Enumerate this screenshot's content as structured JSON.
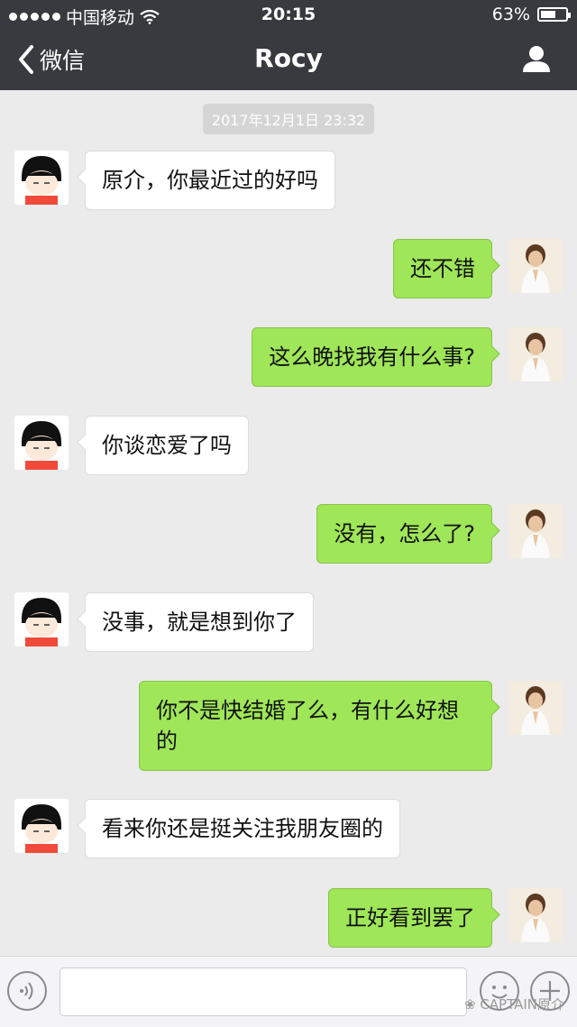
{
  "status": {
    "carrier": "中国移动",
    "time": "20:15",
    "battery": "63%",
    "battery_level": 0.63
  },
  "nav": {
    "back_label": "微信",
    "title": "Rocy"
  },
  "timestamp": "2017年12月1日 23:32",
  "messages": [
    {
      "side": "left",
      "text": "原介，你最近过的好吗"
    },
    {
      "side": "right",
      "text": "还不错"
    },
    {
      "side": "right",
      "text": "这么晚找我有什么事?"
    },
    {
      "side": "left",
      "text": "你谈恋爱了吗"
    },
    {
      "side": "right",
      "text": "没有，怎么了?"
    },
    {
      "side": "left",
      "text": "没事，就是想到你了"
    },
    {
      "side": "right",
      "text": "你不是快结婚了么，有什么好想的"
    },
    {
      "side": "left",
      "text": "看来你还是挺关注我朋友圈的"
    },
    {
      "side": "right",
      "text": "正好看到罢了"
    }
  ],
  "input": {
    "placeholder": ""
  },
  "watermark": "CAPTAIN原介",
  "colors": {
    "header": "#393a3f",
    "background": "#ebebeb",
    "sent_bubble": "#9fe658",
    "received_bubble": "#ffffff"
  }
}
